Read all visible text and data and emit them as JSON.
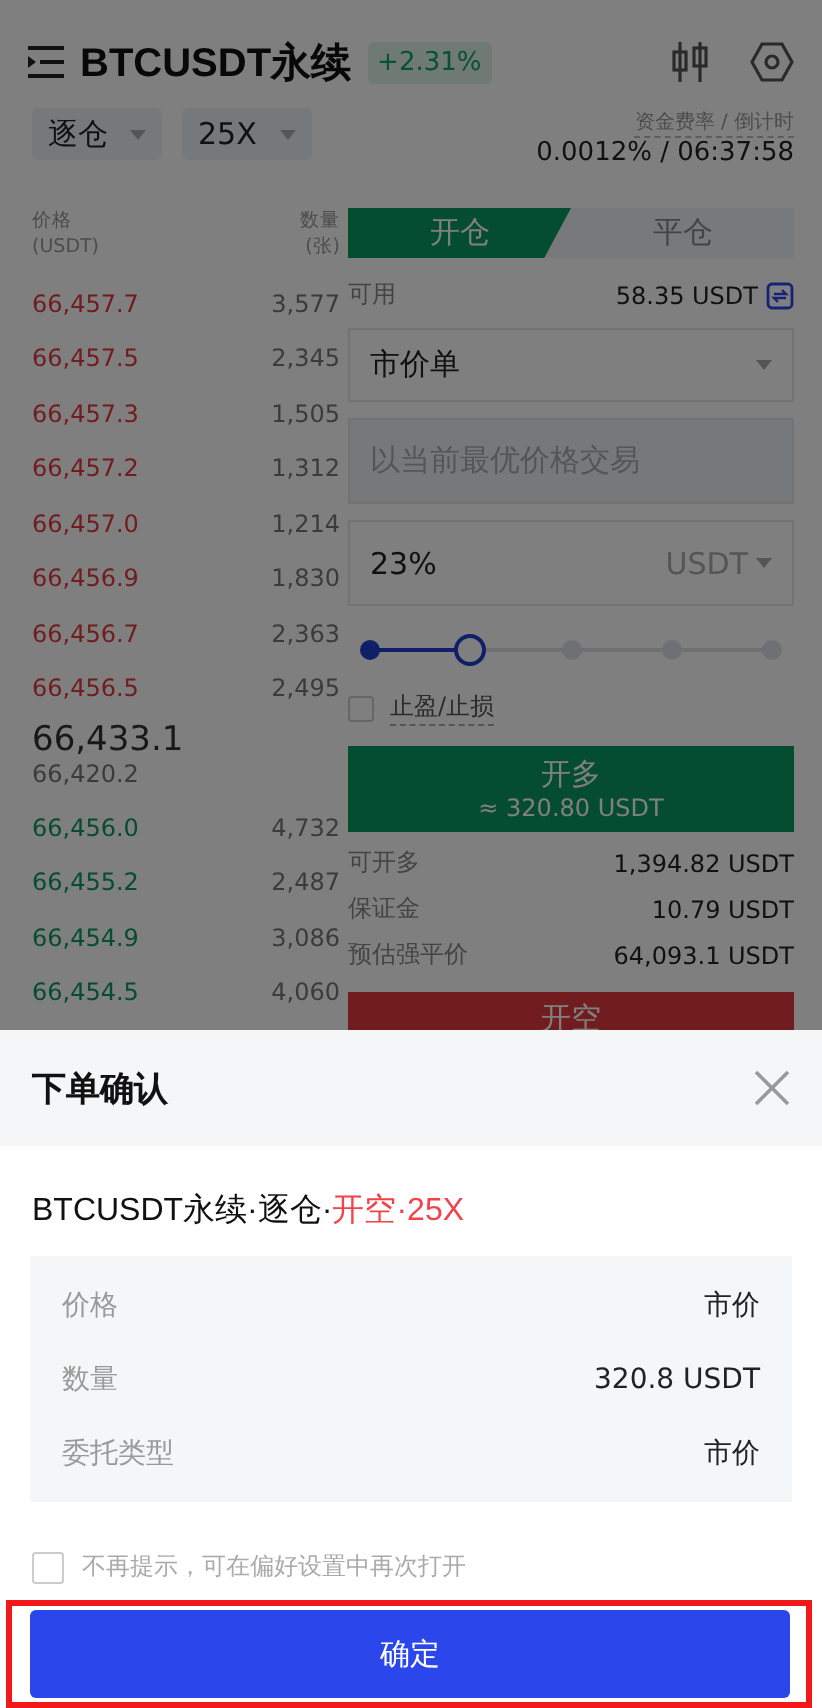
{
  "header": {
    "title": "BTCUSDT永续",
    "change": "+2.31%",
    "margin_mode": "逐仓",
    "leverage": "25X",
    "funding_label": "资金费率 / 倒计时",
    "funding_value": "0.0012% /  06:37:58"
  },
  "orderbook": {
    "columns": [
      {
        "label": "价格",
        "unit": "(USDT)"
      },
      {
        "label": "数量",
        "unit": "(张)"
      }
    ],
    "asks": [
      {
        "price": "66,457.7",
        "qty": "3,577"
      },
      {
        "price": "66,457.5",
        "qty": "2,345"
      },
      {
        "price": "66,457.3",
        "qty": "1,505"
      },
      {
        "price": "66,457.2",
        "qty": "1,312"
      },
      {
        "price": "66,457.0",
        "qty": "1,214"
      },
      {
        "price": "66,456.9",
        "qty": "1,830"
      },
      {
        "price": "66,456.7",
        "qty": "2,363"
      },
      {
        "price": "66,456.5",
        "qty": "2,495"
      }
    ],
    "last_price": "66,433.1",
    "mark_price": "66,420.2",
    "bids": [
      {
        "price": "66,456.0",
        "qty": "4,732"
      },
      {
        "price": "66,455.2",
        "qty": "2,487"
      },
      {
        "price": "66,454.9",
        "qty": "3,086"
      },
      {
        "price": "66,454.5",
        "qty": "4,060"
      }
    ]
  },
  "trade": {
    "tabs": [
      {
        "label": "开仓",
        "selected": true
      },
      {
        "label": "平仓",
        "selected": false
      }
    ],
    "available_label": "可用",
    "available_value": "58.35 USDT",
    "order_type": "市价单",
    "price_placeholder": "以当前最优价格交易",
    "amount": "23%",
    "amount_unit": "USDT",
    "slider": {
      "level": 0.25
    },
    "tpsl": {
      "label": "止盈/止损",
      "checked": false
    },
    "buy": {
      "label": "开多",
      "sub": "≈ 320.80 USDT"
    },
    "info": [
      {
        "label": "可开多",
        "value": "1,394.82 USDT"
      },
      {
        "label": "保证金",
        "value": "10.79 USDT"
      },
      {
        "label": "预估强平价",
        "value": "64,093.1 USDT"
      }
    ],
    "sell": {
      "label": "开空"
    }
  },
  "sheet": {
    "title": "下单确认",
    "summary": "BTCUSDT永续·逐仓·",
    "summary_side": "开空·25X",
    "details": [
      {
        "label": "价格",
        "value": "市价"
      },
      {
        "label": "数量",
        "value": "320.8 USDT"
      },
      {
        "label": "委托类型",
        "value": "市价"
      }
    ],
    "dont_remind": {
      "label": "不再提示，可在偏好设置中再次打开",
      "checked": false
    },
    "confirm": "确定"
  }
}
